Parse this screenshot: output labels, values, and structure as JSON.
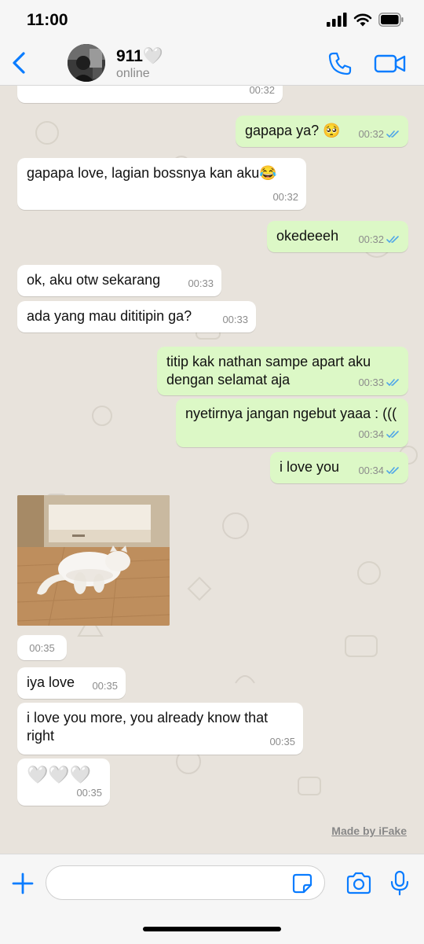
{
  "status_bar": {
    "time": "11:00",
    "icons": [
      "signal-icon",
      "wifi-icon",
      "battery-icon"
    ]
  },
  "header": {
    "contact_name": "911🤍",
    "status": "online",
    "icons": [
      "back-chevron-icon",
      "phone-icon",
      "video-camera-icon"
    ],
    "accent_color": "#0a7cff"
  },
  "colors": {
    "incoming": "#ffffff",
    "outgoing": "#dcf8c6",
    "wallpaper": "#e8e3dc",
    "read_ticks": "#4fa6e8"
  },
  "messages": [
    {
      "dir": "in",
      "text": "",
      "time": "00:32",
      "partial": true
    },
    {
      "dir": "out",
      "text": "gapapa ya? 🥺",
      "time": "00:32",
      "read": true
    },
    {
      "dir": "in",
      "text": "gapapa love, lagian bossnya kan aku😂",
      "time": "00:32"
    },
    {
      "dir": "out",
      "text": "okedeeeh",
      "time": "00:32",
      "read": true
    },
    {
      "dir": "in",
      "text": "ok, aku otw sekarang",
      "time": "00:33"
    },
    {
      "dir": "in",
      "text": "ada yang mau dititipin ga?",
      "time": "00:33"
    },
    {
      "dir": "out",
      "text": "titip kak nathan sampe apart aku dengan selamat aja",
      "time": "00:33",
      "read": true
    },
    {
      "dir": "out",
      "text": "nyetirnya jangan ngebut yaaa : (((",
      "time": "00:34",
      "read": true
    },
    {
      "dir": "out",
      "text": "i love you",
      "time": "00:34",
      "read": true
    },
    {
      "dir": "in",
      "type": "photo",
      "description": "white cat lying on wooden floor"
    },
    {
      "dir": "in",
      "text": "",
      "time": "00:35"
    },
    {
      "dir": "in",
      "text": "iya love",
      "time": "00:35"
    },
    {
      "dir": "in",
      "text": "i love you more, you already know that right",
      "time": "00:35"
    },
    {
      "dir": "in",
      "text": "🤍🤍🤍",
      "time": "00:35"
    }
  ],
  "watermark": "Made by iFake",
  "input_bar": {
    "icons": [
      "plus-icon",
      "sticker-icon",
      "camera-icon",
      "microphone-icon"
    ]
  }
}
